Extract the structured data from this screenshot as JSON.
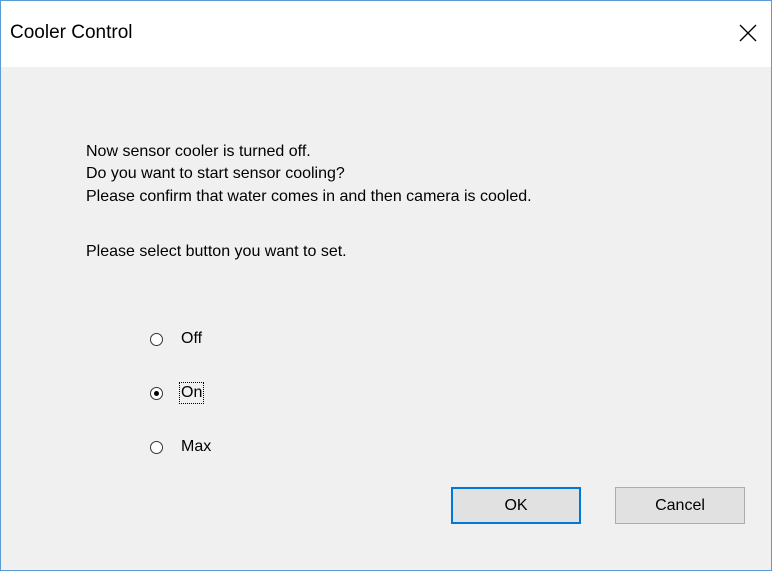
{
  "window": {
    "title": "Cooler Control",
    "accent_color": "#0078d7",
    "border_color": "#5b9bd5"
  },
  "message": {
    "line1": "Now sensor cooler is turned off.",
    "line2": "Do you want to start sensor cooling?",
    "line3": "Please confirm that water comes in and then camera is cooled.",
    "line4": "Please select button you want to set."
  },
  "options": [
    {
      "label": "Off",
      "selected": false
    },
    {
      "label": "On",
      "selected": true,
      "focused": true
    },
    {
      "label": "Max",
      "selected": false
    }
  ],
  "buttons": {
    "ok_label": "OK",
    "cancel_label": "Cancel"
  }
}
